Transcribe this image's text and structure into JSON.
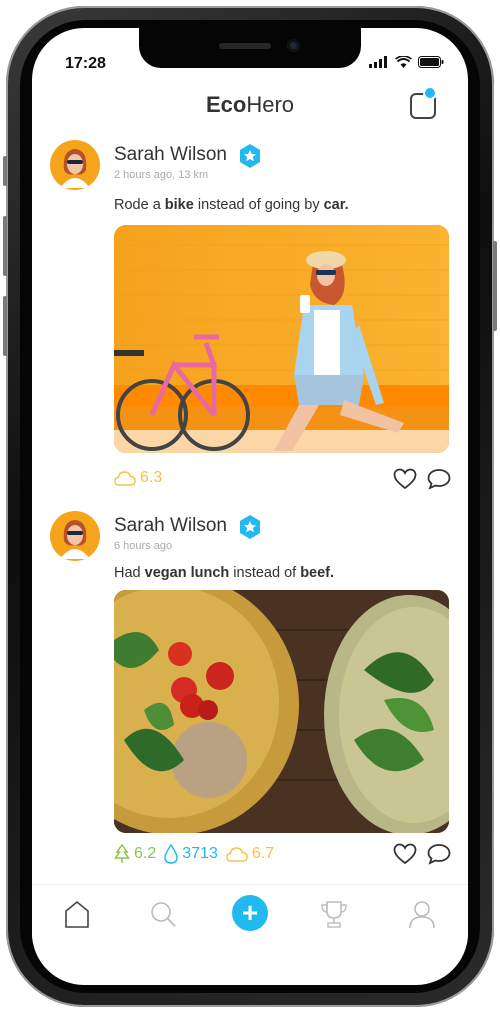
{
  "status_bar": {
    "time": "17:28"
  },
  "app": {
    "brand_bold": "Eco",
    "brand_rest": "Hero"
  },
  "posts": [
    {
      "name": "Sarah Wilson",
      "meta": "2 hours ago, 13 km",
      "caption_pre": "Rode a ",
      "caption_bold1": "bike",
      "caption_mid": " instead of going by ",
      "caption_bold2": "car.",
      "stats": {
        "cloud": "6.3"
      }
    },
    {
      "name": "Sarah Wilson",
      "meta": "6 hours ago",
      "caption_pre": "Had ",
      "caption_bold1": "vegan lunch",
      "caption_mid": " instead of ",
      "caption_bold2": "beef.",
      "stats": {
        "tree": "6.2",
        "water": "3713",
        "cloud": "6.7"
      }
    }
  ],
  "nav": {
    "items": [
      "home-icon",
      "search-icon",
      "add-button",
      "trophy-icon",
      "profile-icon"
    ]
  },
  "colors": {
    "accent": "#22b8f0",
    "cloud": "#f6c24a",
    "tree": "#8bc34a",
    "water": "#22b8f0"
  }
}
